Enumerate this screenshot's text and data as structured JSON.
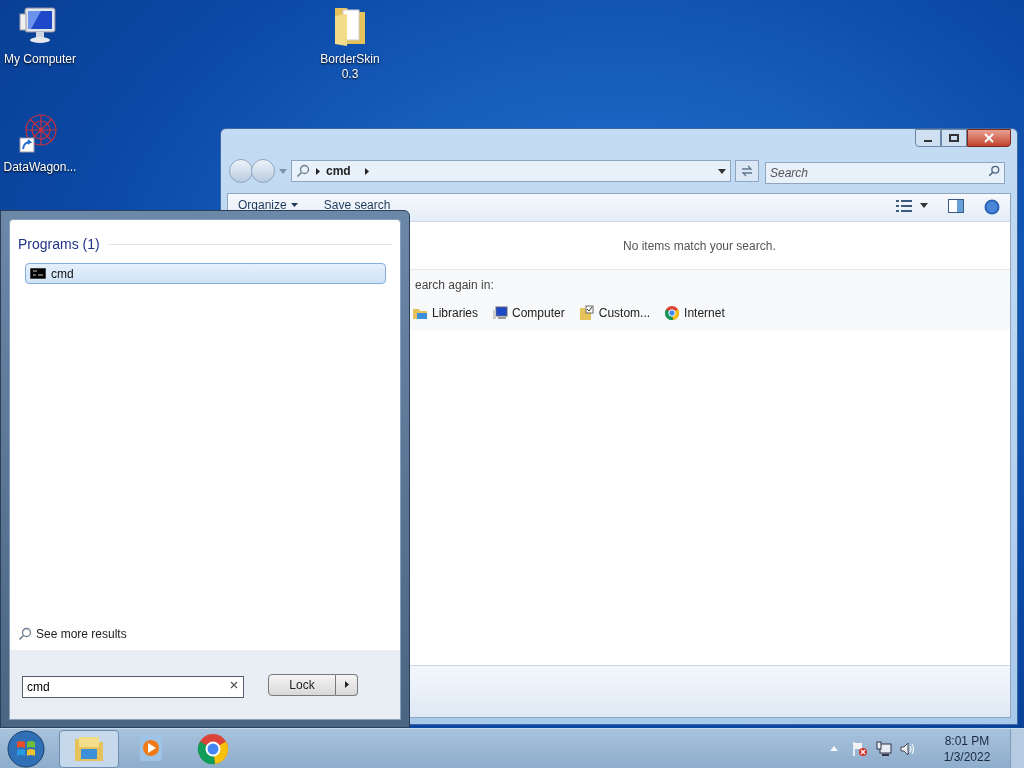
{
  "desktop_icons": [
    {
      "label": "My Computer",
      "kind": "computer"
    },
    {
      "label": "BorderSkin 0.3",
      "kind": "folder"
    },
    {
      "label": "DataWagon...",
      "kind": "shortcut"
    }
  ],
  "explorer": {
    "breadcrumb": "cmd",
    "search": {
      "placeholder": "Search"
    },
    "toolbar": [
      "Organize",
      "Save search"
    ],
    "message": "No items match your search.",
    "search_again_label": "earch again in:",
    "locations": [
      {
        "label": "Libraries",
        "kind": "libraries"
      },
      {
        "label": "Computer",
        "kind": "computer"
      },
      {
        "label": "Custom...",
        "kind": "custom"
      },
      {
        "label": "Internet",
        "kind": "internet"
      }
    ]
  },
  "start_menu": {
    "section": "Programs (1)",
    "results": [
      {
        "label": "cmd",
        "selected": true
      }
    ],
    "see_more": "See more results",
    "search": {
      "value": "cmd"
    },
    "power_button": "Lock"
  },
  "taskbar": {
    "apps": [
      {
        "kind": "explorer",
        "active": true
      },
      {
        "kind": "media",
        "active": false
      },
      {
        "kind": "chrome",
        "active": false
      }
    ],
    "time": "8:01 PM",
    "date": "1/3/2022"
  }
}
